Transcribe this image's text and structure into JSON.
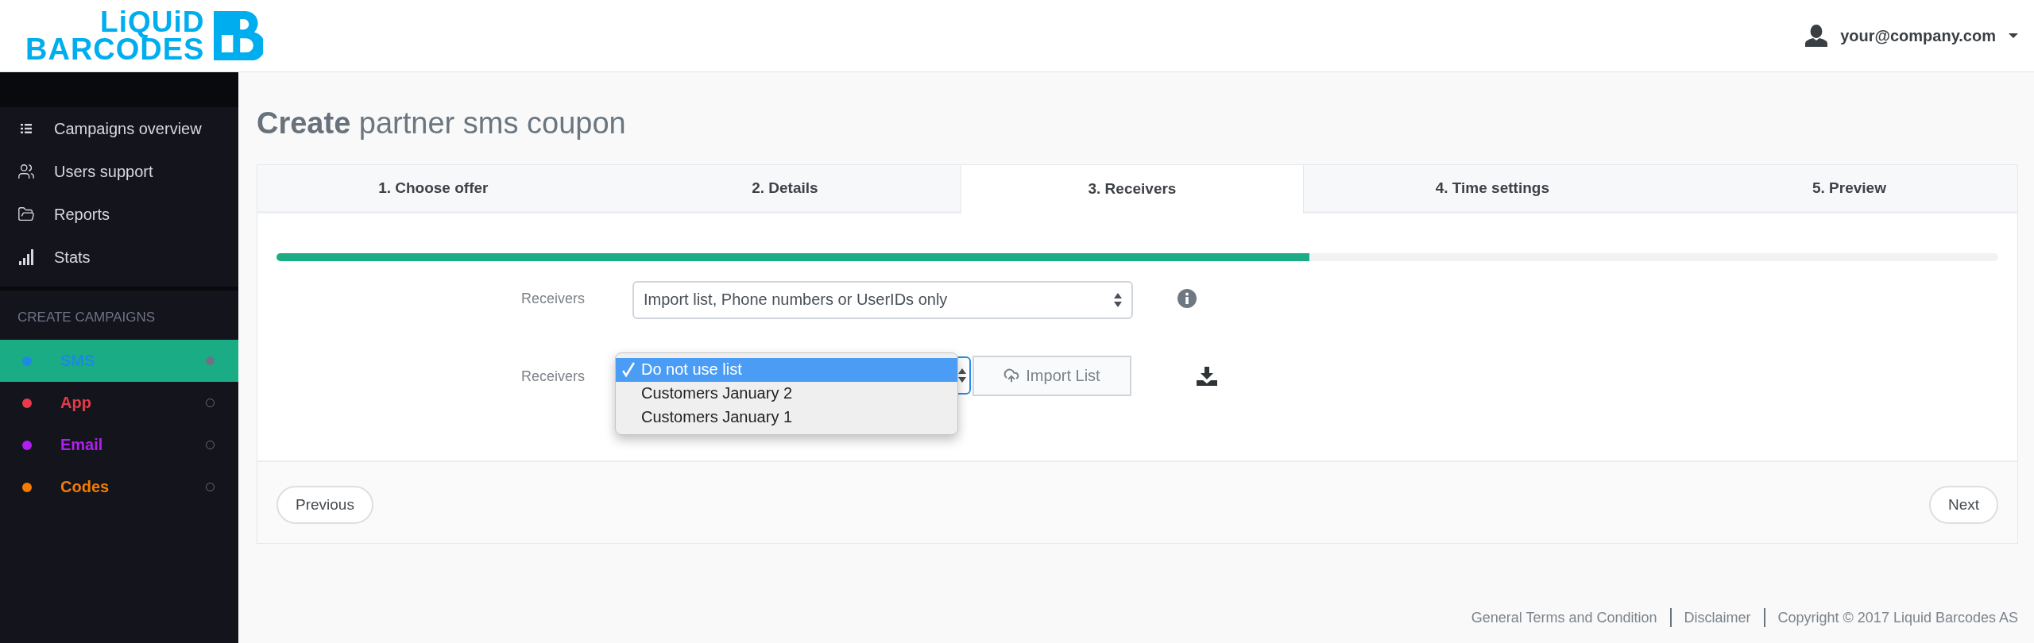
{
  "logo": {
    "line_1": "LiQUiD",
    "line_2": "BARCODES"
  },
  "user_menu": {
    "email": "your@company.com"
  },
  "sidebar": {
    "items": [
      {
        "label": "Campaigns overview"
      },
      {
        "label": "Users support"
      },
      {
        "label": "Reports"
      },
      {
        "label": "Stats"
      }
    ],
    "section_title": "CREATE CAMPAIGNS",
    "campaigns": [
      {
        "label": "SMS",
        "color": "#1e88e5",
        "selected": true
      },
      {
        "label": "App",
        "color": "#e83a4a",
        "selected": false
      },
      {
        "label": "Email",
        "color": "#b01ff0",
        "selected": false
      },
      {
        "label": "Codes",
        "color": "#f57c00",
        "selected": false
      }
    ]
  },
  "page": {
    "title": "**Create** partner sms coupon"
  },
  "wizard": {
    "tabs": [
      {
        "label": "1. Choose offer",
        "selected": false
      },
      {
        "label": "2. Details",
        "selected": false
      },
      {
        "label": "3. Receivers",
        "selected": true
      },
      {
        "label": "4. Time settings",
        "selected": false
      },
      {
        "label": "5. Preview",
        "selected": false
      }
    ],
    "progress": {
      "level": 0.6
    },
    "fields": [
      {
        "kind": "select",
        "label": "Receivers",
        "value": "Import list, Phone numbers or UserIDs only"
      },
      {
        "kind": "list_picker",
        "label": "Receivers",
        "options": [
          {
            "label": "Do not use list",
            "selected": true
          },
          {
            "label": "Customers January 2",
            "selected": false
          },
          {
            "label": "Customers January 1",
            "selected": false
          }
        ],
        "button": "Import List"
      }
    ],
    "previous_button": "Previous",
    "next_button": "Next"
  },
  "footer": {
    "links": [
      "General Terms and Condition",
      "Disclaimer"
    ],
    "copyright": "Copyright © 2017 Liquid Barcodes AS"
  }
}
